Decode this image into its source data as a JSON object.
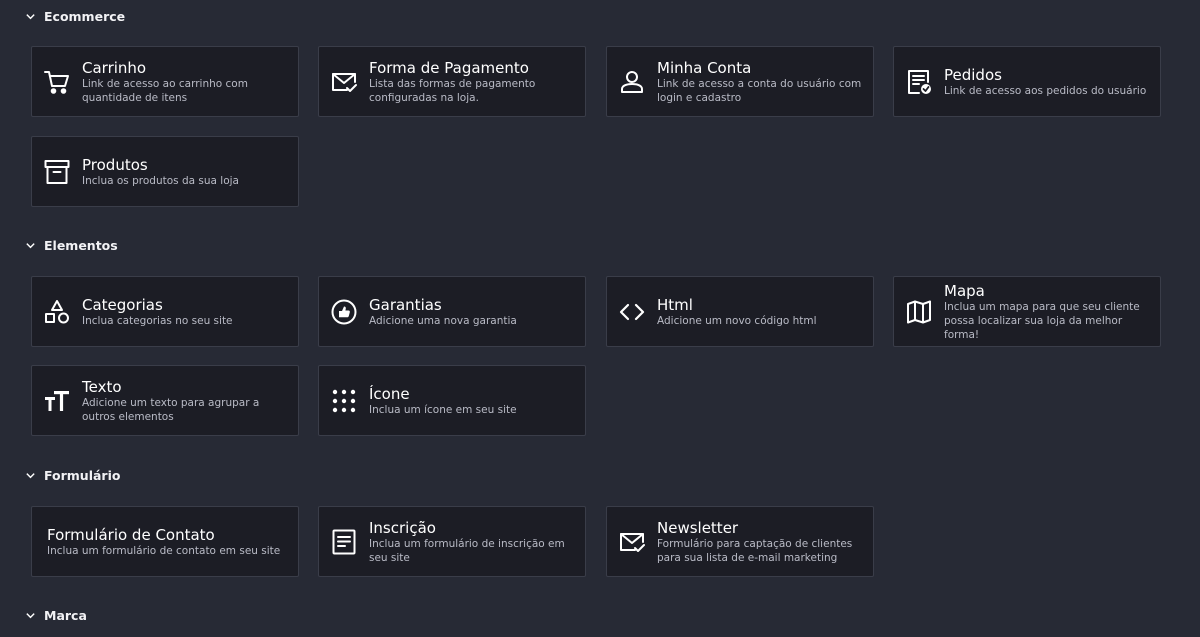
{
  "sections": {
    "ecommerce": {
      "title": "Ecommerce",
      "cards": [
        {
          "title": "Carrinho",
          "desc": "Link de acesso ao carrinho com quantidade de itens",
          "icon": "cart-icon"
        },
        {
          "title": "Forma de Pagamento",
          "desc": "Lista das formas de pagamento configuradas na loja.",
          "icon": "mail-check-icon"
        },
        {
          "title": "Minha Conta",
          "desc": "Link de acesso a conta do usuário com login e cadastro",
          "icon": "user-icon"
        },
        {
          "title": "Pedidos",
          "desc": "Link de acesso aos pedidos do usuário",
          "icon": "receipt-check-icon"
        },
        {
          "title": "Produtos",
          "desc": "Inclua os produtos da sua loja",
          "icon": "archive-box-icon"
        }
      ]
    },
    "elementos": {
      "title": "Elementos",
      "cards": [
        {
          "title": "Categorias",
          "desc": "Inclua categorias no seu site",
          "icon": "shapes-icon"
        },
        {
          "title": "Garantias",
          "desc": "Adicione uma nova garantia",
          "icon": "thumbs-up-circle-icon"
        },
        {
          "title": "Html",
          "desc": "Adicione um novo código html",
          "icon": "code-icon"
        },
        {
          "title": "Mapa",
          "desc": "Inclua um mapa para que seu cliente possa localizar sua loja da melhor forma!",
          "icon": "map-icon"
        },
        {
          "title": "Texto",
          "desc": "Adicione um texto para agrupar a outros elementos",
          "icon": "text-size-icon"
        },
        {
          "title": "Ícone",
          "desc": "Inclua um ícone em seu site",
          "icon": "dots-grid-icon"
        }
      ]
    },
    "formulario": {
      "title": "Formulário",
      "cards": [
        {
          "title": "Formulário de Contato",
          "desc": "Inclua um formulário de contato em seu site"
        },
        {
          "title": "Inscrição",
          "desc": "Inclua um formulário de inscrição em seu site",
          "icon": "document-lines-icon"
        },
        {
          "title": "Newsletter",
          "desc": "Formulário para captação de clientes para sua lista de e-mail marketing",
          "icon": "mail-check-icon"
        }
      ]
    },
    "marca": {
      "title": "Marca"
    }
  },
  "colors": {
    "background": "#272a35",
    "card_background": "#1c1d25",
    "card_border": "#3a3d49",
    "text": "#ffffff",
    "muted_text": "#b9bbc6"
  }
}
